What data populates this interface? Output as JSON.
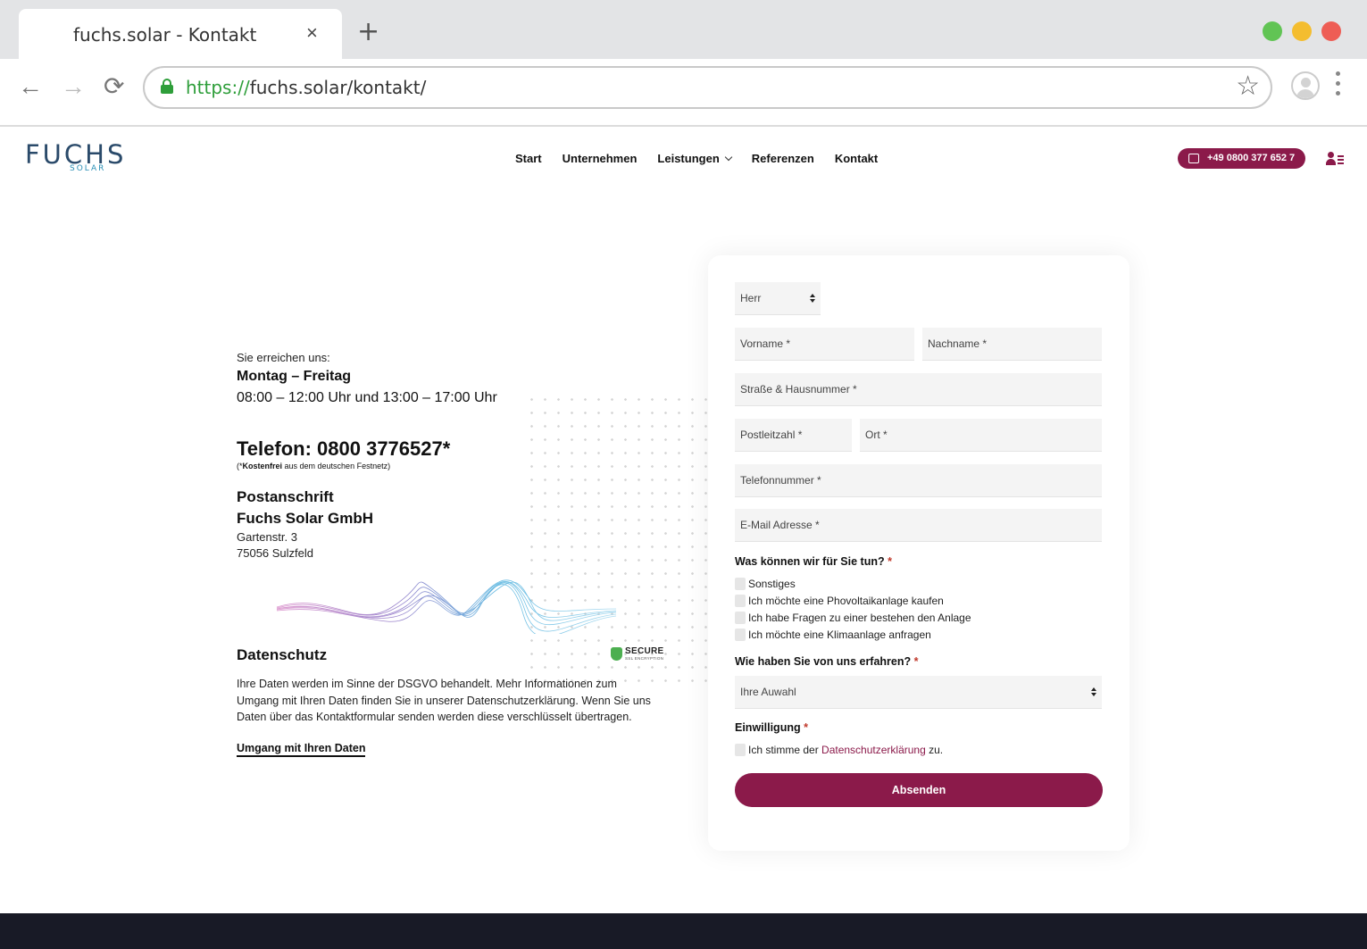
{
  "browser": {
    "tab_title": "fuchs.solar - Kontakt",
    "tab_close": "×",
    "new_tab": "+",
    "url_proto": "https://",
    "url_rest": "fuchs.solar/kontakt/",
    "back": "←",
    "forward": "→",
    "reload": "⟳",
    "star": "☆"
  },
  "site": {
    "logo_word": "FUCHS",
    "logo_sub": "SOLAR",
    "menu": [
      "Start",
      "Unternehmen",
      "Leistungen",
      "Referenzen",
      "Kontakt"
    ],
    "phone": "+49 0800 377 652 7"
  },
  "info": {
    "reach": "Sie erreichen uns:",
    "days": "Montag – Freitag",
    "hours": "08:00 – 12:00 Uhr und 13:00 – 17:00 Uhr",
    "telefon": "Telefon: 0800 3776527*",
    "tel_note_prefix": "(*",
    "tel_note_bold": "Kostenfrei",
    "tel_note_rest": " aus dem deutschen Festnetz)",
    "post_title": "Postanschrift",
    "company": "Fuchs Solar GmbH",
    "street": "Gartenstr. 3",
    "city": "75056 Sulzfeld",
    "privacy_title": "Datenschutz",
    "privacy_text": "Ihre Daten werden im Sinne der DSGVO behandelt. Mehr Informationen zum Umgang mit Ihren Daten finden Sie in unserer Datenschutzerklärung. Wenn Sie uns Daten über das Kontaktformular senden werden diese verschlüsselt übertragen.",
    "privacy_link": "Umgang mit Ihren Daten",
    "secure": "SECURE",
    "secure_sub": "SSL ENCRYPTION"
  },
  "form": {
    "salutation": "Herr",
    "vorname": "Vorname *",
    "nachname": "Nachname *",
    "strasse": "Straße & Hausnummer *",
    "plz": "Postleitzahl *",
    "ort": "Ort *",
    "telefon": "Telefonnummer *",
    "email": "E-Mail Adresse *",
    "q1_label": "Was können wir für Sie tun?",
    "q1_options": [
      "Sonstiges",
      "Ich möchte eine Phovoltaikanlage kaufen",
      "Ich habe Fragen zu einer bestehen den Anlage",
      "Ich möchte eine Klimaanlage anfragen"
    ],
    "q2_label": "Wie haben Sie von uns erfahren?",
    "q2_value": "Ihre Auwahl",
    "consent_label": "Einwilligung",
    "consent_pre": "Ich stimme der ",
    "consent_link": "Datenschutzerklärung",
    "consent_post": " zu.",
    "required_mark": "*",
    "submit": "Absenden"
  }
}
